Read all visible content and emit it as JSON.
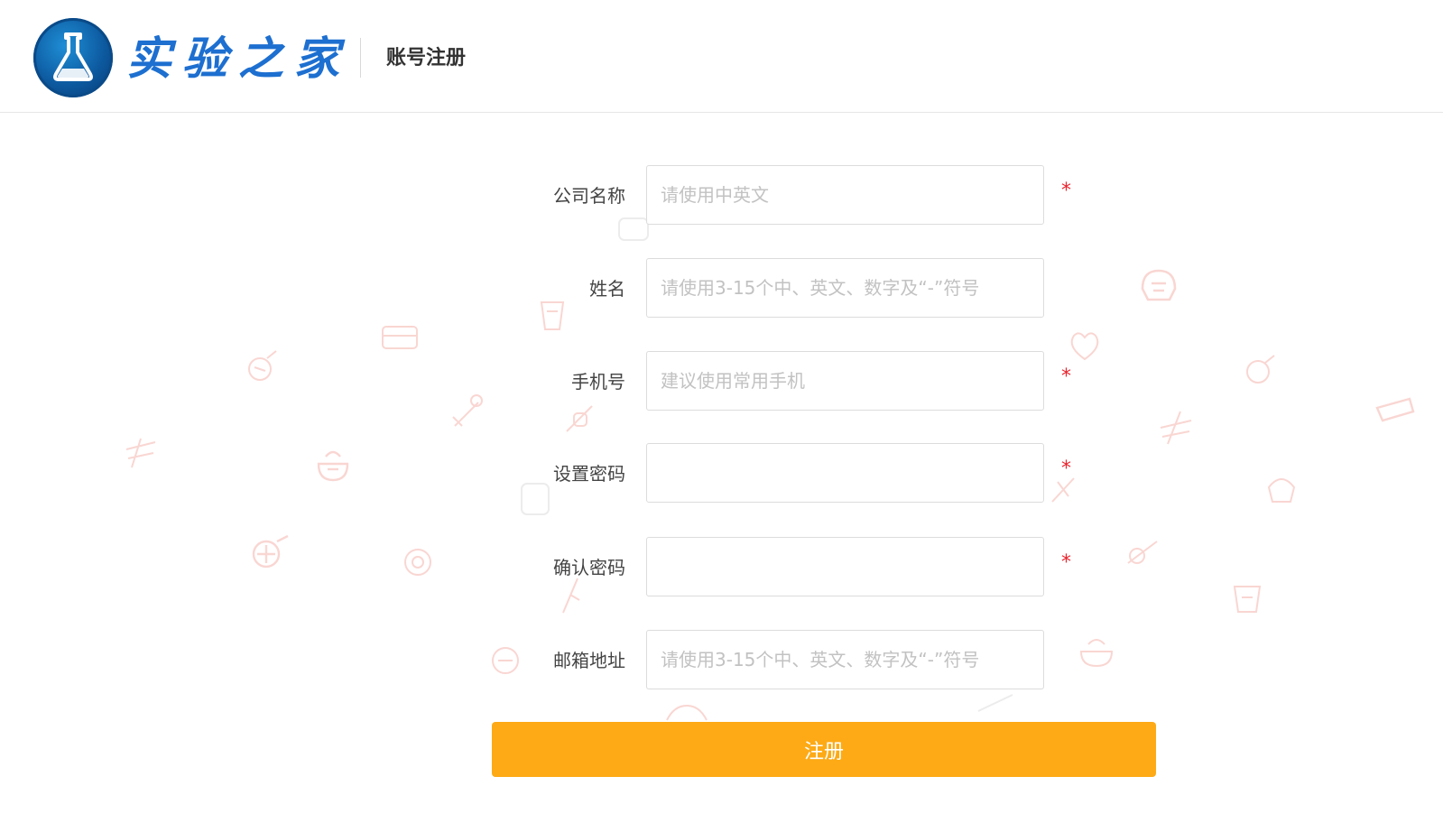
{
  "header": {
    "logo_text": "实验之家",
    "page_title": "账号注册"
  },
  "form": {
    "fields": [
      {
        "label": "公司名称",
        "placeholder": "请使用中英文",
        "value": "",
        "required": true
      },
      {
        "label": "姓名",
        "placeholder": "请使用3-15个中、英文、数字及“-”符号",
        "value": "",
        "required": false
      },
      {
        "label": "手机号",
        "placeholder": "建议使用常用手机",
        "value": "",
        "required": true
      },
      {
        "label": "设置密码",
        "placeholder": "",
        "value": "",
        "required": true
      },
      {
        "label": "确认密码",
        "placeholder": "",
        "value": "",
        "required": true
      },
      {
        "label": "邮箱地址",
        "placeholder": "请使用3-15个中、英文、数字及“-”符号",
        "value": "",
        "required": false
      }
    ],
    "required_mark": "*",
    "submit_label": "注册"
  },
  "colors": {
    "accent": "#fdaa16",
    "brand_blue": "#1d6fd0",
    "required": "#e8252f"
  },
  "icons": {
    "logo": "flask-icon",
    "background": "food-doodle-icon"
  }
}
